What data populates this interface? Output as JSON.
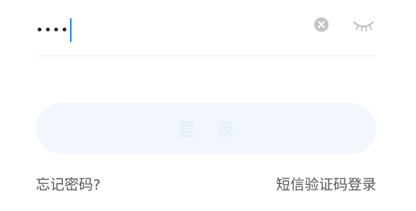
{
  "password_field": {
    "masked_value": "••••"
  },
  "login_button": {
    "label": "登 录"
  },
  "links": {
    "forgot_password": "忘记密码?",
    "sms_login": "短信验证码登录"
  },
  "colors": {
    "caret": "#2a8fe6",
    "button_bg": "#f1f7fd",
    "button_text": "#e0edf9",
    "link_text": "#555555",
    "icon_gray": "#c4c4c4"
  },
  "icons": {
    "clear": "clear-circle-icon",
    "visibility": "eye-closed-icon"
  }
}
